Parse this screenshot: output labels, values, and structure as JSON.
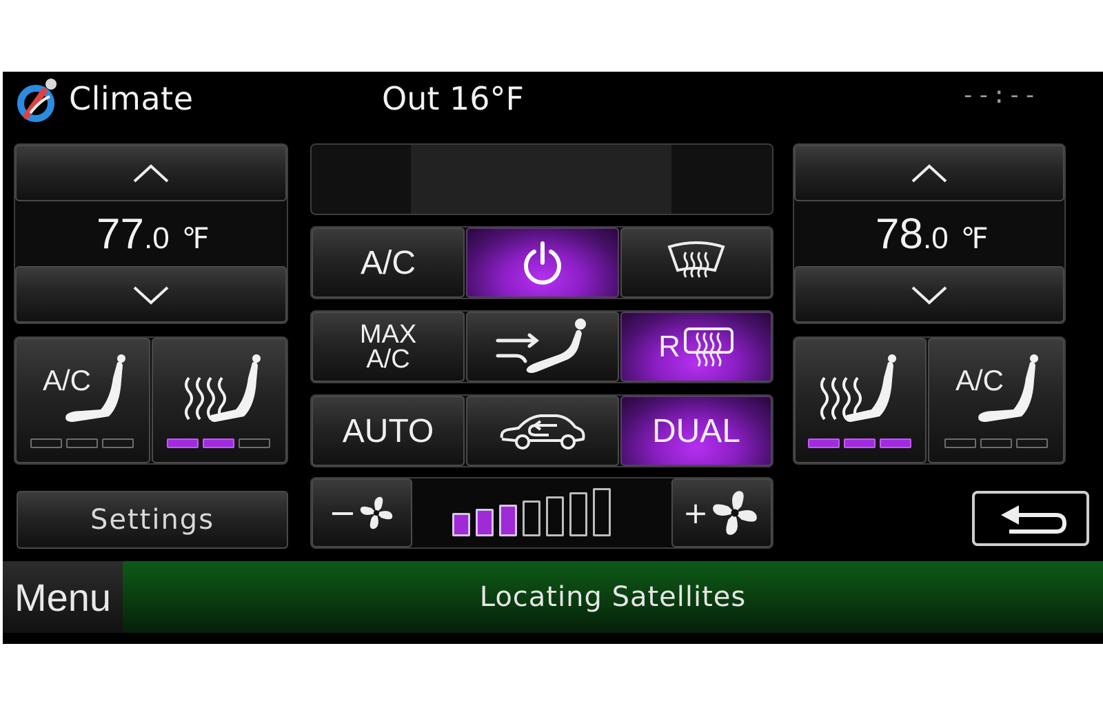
{
  "header": {
    "title": "Climate",
    "outside_temp": "Out 16°F",
    "clock": "--:--"
  },
  "driver": {
    "temp_whole": "77",
    "temp_decimal": ".0",
    "temp_unit": "℉",
    "seat_cool": {
      "label": "A/C",
      "level": 0,
      "max": 3
    },
    "seat_heat": {
      "level": 2,
      "max": 3
    }
  },
  "passenger": {
    "temp_whole": "78",
    "temp_decimal": ".0",
    "temp_unit": "℉",
    "seat_heat": {
      "level": 3,
      "max": 3
    },
    "seat_cool": {
      "label": "A/C",
      "level": 0,
      "max": 3
    }
  },
  "controls": {
    "ac": {
      "label": "A/C",
      "active": false
    },
    "power": {
      "icon": "power-icon",
      "active": true
    },
    "front_defrost": {
      "icon": "front-defrost-icon",
      "active": false
    },
    "max_ac": {
      "label_line1": "MAX",
      "label_line2": "A/C",
      "active": false
    },
    "airflow": {
      "icon": "airflow-mode-icon",
      "active": false
    },
    "rear_defrost": {
      "label": "R",
      "icon": "rear-defrost-icon",
      "active": true
    },
    "auto": {
      "label": "AUTO",
      "active": false
    },
    "recirculate": {
      "icon": "recirculate-icon",
      "active": false
    },
    "dual": {
      "label": "DUAL",
      "active": true
    }
  },
  "fan": {
    "minus_label": "−",
    "plus_label": "+",
    "level": 3,
    "max": 7
  },
  "settings_label": "Settings",
  "menu_label": "Menu",
  "status_text": "Locating Satellites",
  "colors": {
    "accent": "#a12be0",
    "status_green": "#0a3f10",
    "background": "#000000"
  }
}
